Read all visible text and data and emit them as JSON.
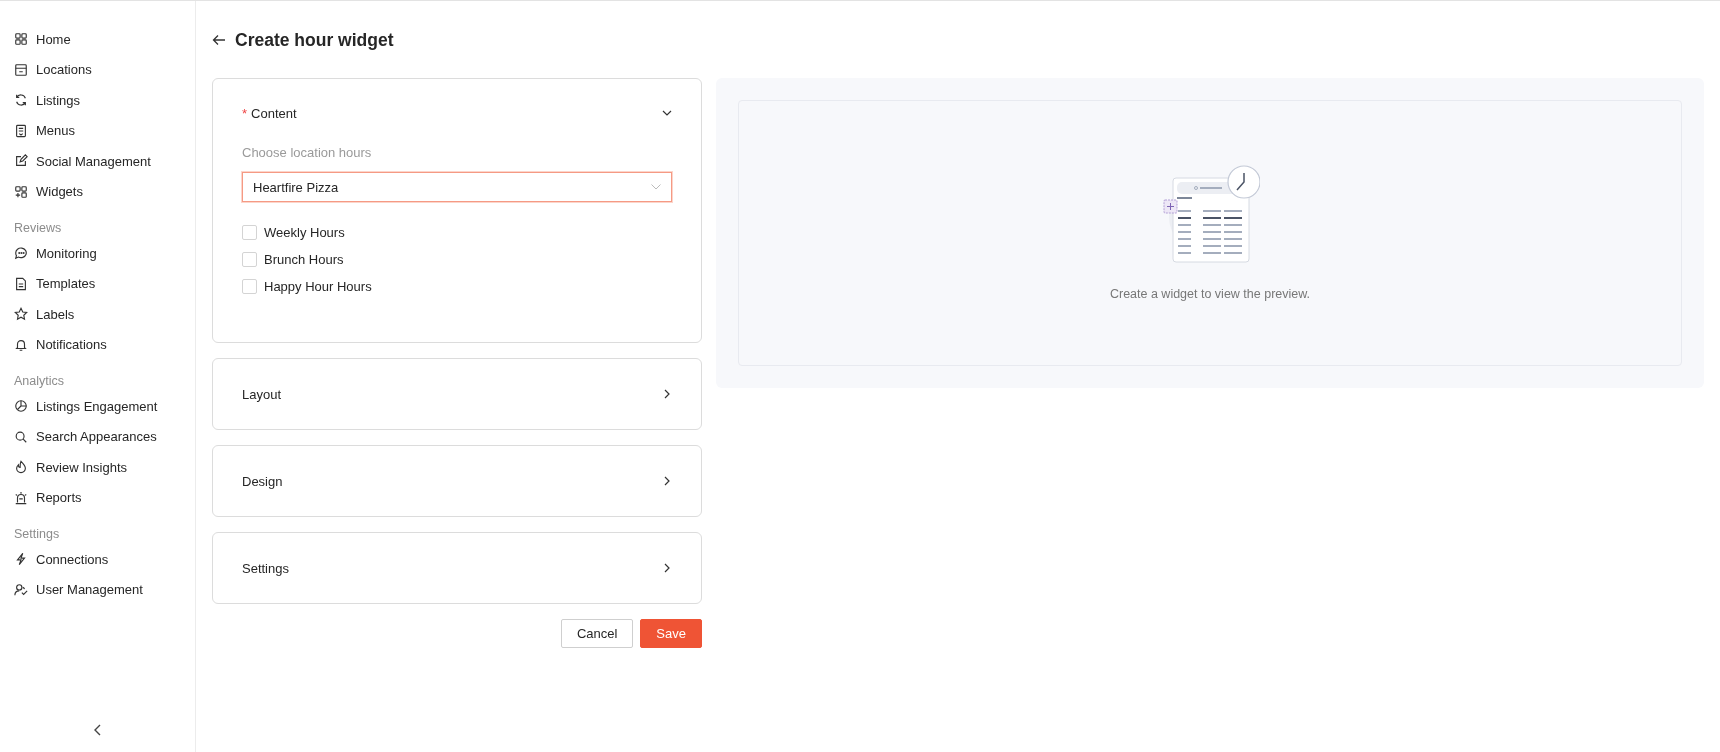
{
  "sidebar": {
    "groups": [
      {
        "items": [
          {
            "label": "Home",
            "selected": false
          },
          {
            "label": "Locations",
            "selected": false
          },
          {
            "label": "Listings",
            "selected": false
          },
          {
            "label": "Menus",
            "selected": false
          },
          {
            "label": "Social Management",
            "selected": false
          },
          {
            "label": "Widgets",
            "selected": false
          }
        ]
      },
      {
        "title": "Reviews",
        "items": [
          {
            "label": "Monitoring",
            "selected": false
          },
          {
            "label": "Templates",
            "selected": false
          },
          {
            "label": "Labels",
            "selected": false
          },
          {
            "label": "Notifications",
            "selected": false
          }
        ]
      },
      {
        "title": "Analytics",
        "items": [
          {
            "label": "Listings Engagement",
            "selected": false
          },
          {
            "label": "Search Appearances",
            "selected": false
          },
          {
            "label": "Review Insights",
            "selected": false
          },
          {
            "label": "Reports",
            "selected": false
          }
        ]
      },
      {
        "title": "Settings",
        "items": [
          {
            "label": "Connections",
            "selected": false
          },
          {
            "label": "User Management",
            "selected": false
          }
        ]
      }
    ]
  },
  "page": {
    "title": "Create hour widget"
  },
  "sections": [
    {
      "title": "Content",
      "required_mark": "*",
      "expanded": true,
      "field_label": "Choose location hours",
      "select": {
        "value": "Heartfire Pizza"
      },
      "options": [
        {
          "label": "Weekly Hours",
          "checked": false
        },
        {
          "label": "Brunch Hours",
          "checked": false
        },
        {
          "label": "Happy Hour Hours",
          "checked": false
        }
      ]
    },
    {
      "title": "Layout",
      "expanded": false
    },
    {
      "title": "Design",
      "expanded": false
    },
    {
      "title": "Settings",
      "expanded": false
    }
  ],
  "buttons": [
    {
      "label": "Cancel",
      "kind": "secondary"
    },
    {
      "label": "Save",
      "kind": "primary"
    }
  ],
  "preview": {
    "message": "Create a widget to view the preview."
  }
}
